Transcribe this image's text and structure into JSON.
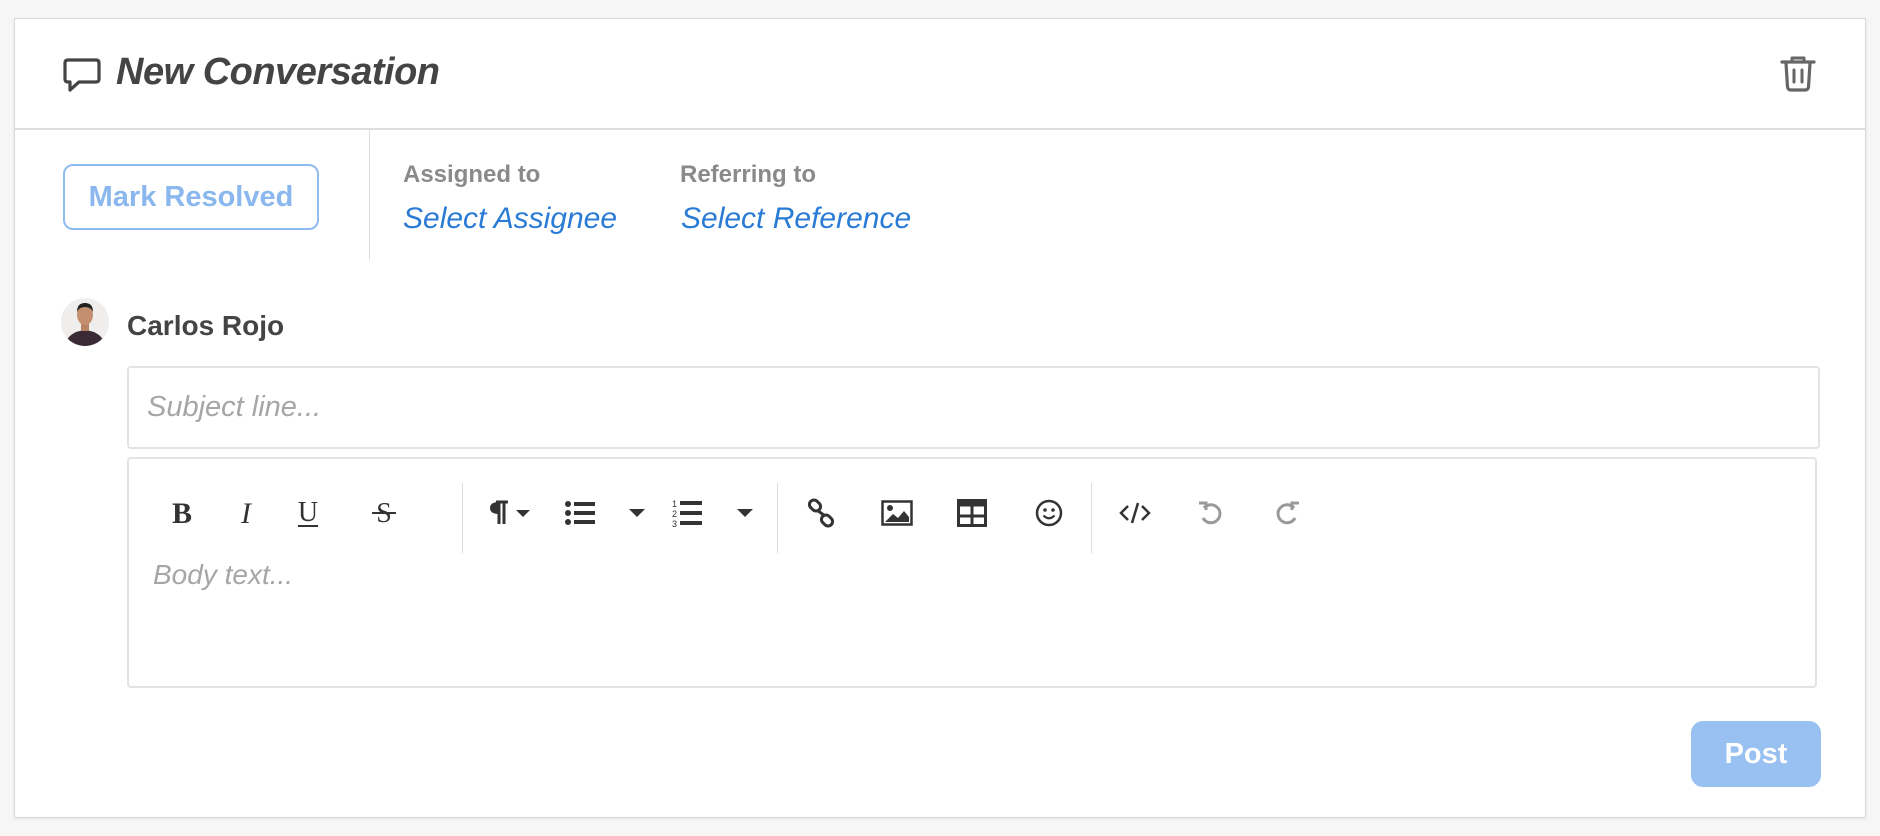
{
  "header": {
    "title": "New Conversation",
    "title_icon": "speech-bubble-icon",
    "delete_icon": "trash-icon"
  },
  "actions": {
    "resolve_label": "Mark Resolved"
  },
  "meta": {
    "assigned_label": "Assigned to",
    "assigned_value": "Select Assignee",
    "referring_label": "Referring to",
    "referring_value": "Select Reference"
  },
  "author": {
    "name": "Carlos Rojo"
  },
  "composer": {
    "subject_placeholder": "Subject line...",
    "subject_value": "",
    "body_placeholder": "Body text...",
    "toolbar": [
      "bold-icon",
      "italic-icon",
      "underline-icon",
      "strikethrough-icon",
      "paragraph-icon",
      "bullet-list-icon",
      "numbered-list-icon",
      "link-icon",
      "image-icon",
      "table-icon",
      "emoji-icon",
      "code-icon",
      "undo-icon",
      "redo-icon"
    ],
    "post_label": "Post"
  },
  "colors": {
    "accent": "#2a7bd6",
    "resolve_border": "#90bbef",
    "post_bg": "#98c0f1",
    "text": "#444444",
    "muted": "#8a8a8a"
  }
}
